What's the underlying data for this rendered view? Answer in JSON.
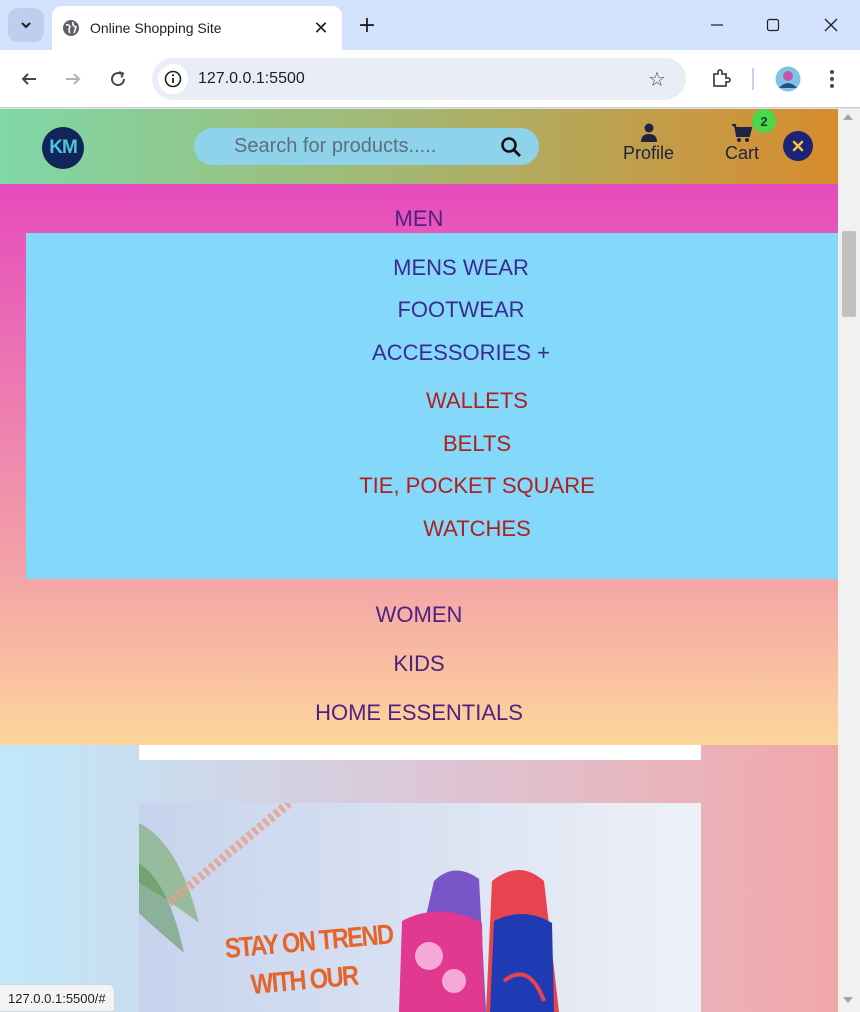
{
  "browser": {
    "tab_title": "Online Shopping Site",
    "url": "127.0.0.1:5500",
    "status_url": "127.0.0.1:5500/#"
  },
  "header": {
    "logo_text": "KM",
    "search_placeholder": "Search for products.....",
    "profile_label": "Profile",
    "cart_label": "Cart",
    "cart_count": "2"
  },
  "menu": {
    "men": "MEN",
    "submenu": {
      "mens_wear": "MENS WEAR",
      "footwear": "FOOTWEAR",
      "accessories": "ACCESSORIES +",
      "accessories_items": [
        "WALLETS",
        "BELTS",
        "TIE, POCKET SQUARE",
        "WATCHES"
      ]
    },
    "women": "WOMEN",
    "kids": "KIDS",
    "home_essentials": "HOME ESSENTIALS"
  },
  "banner": {
    "line1": "STAY ON TREND",
    "line2": "WITH OUR"
  },
  "colors": {
    "menu_text": "#4d2280",
    "accessory_text": "#b0211e",
    "submenu_bg": "#84d8f9",
    "badge": "#4bd84b"
  }
}
